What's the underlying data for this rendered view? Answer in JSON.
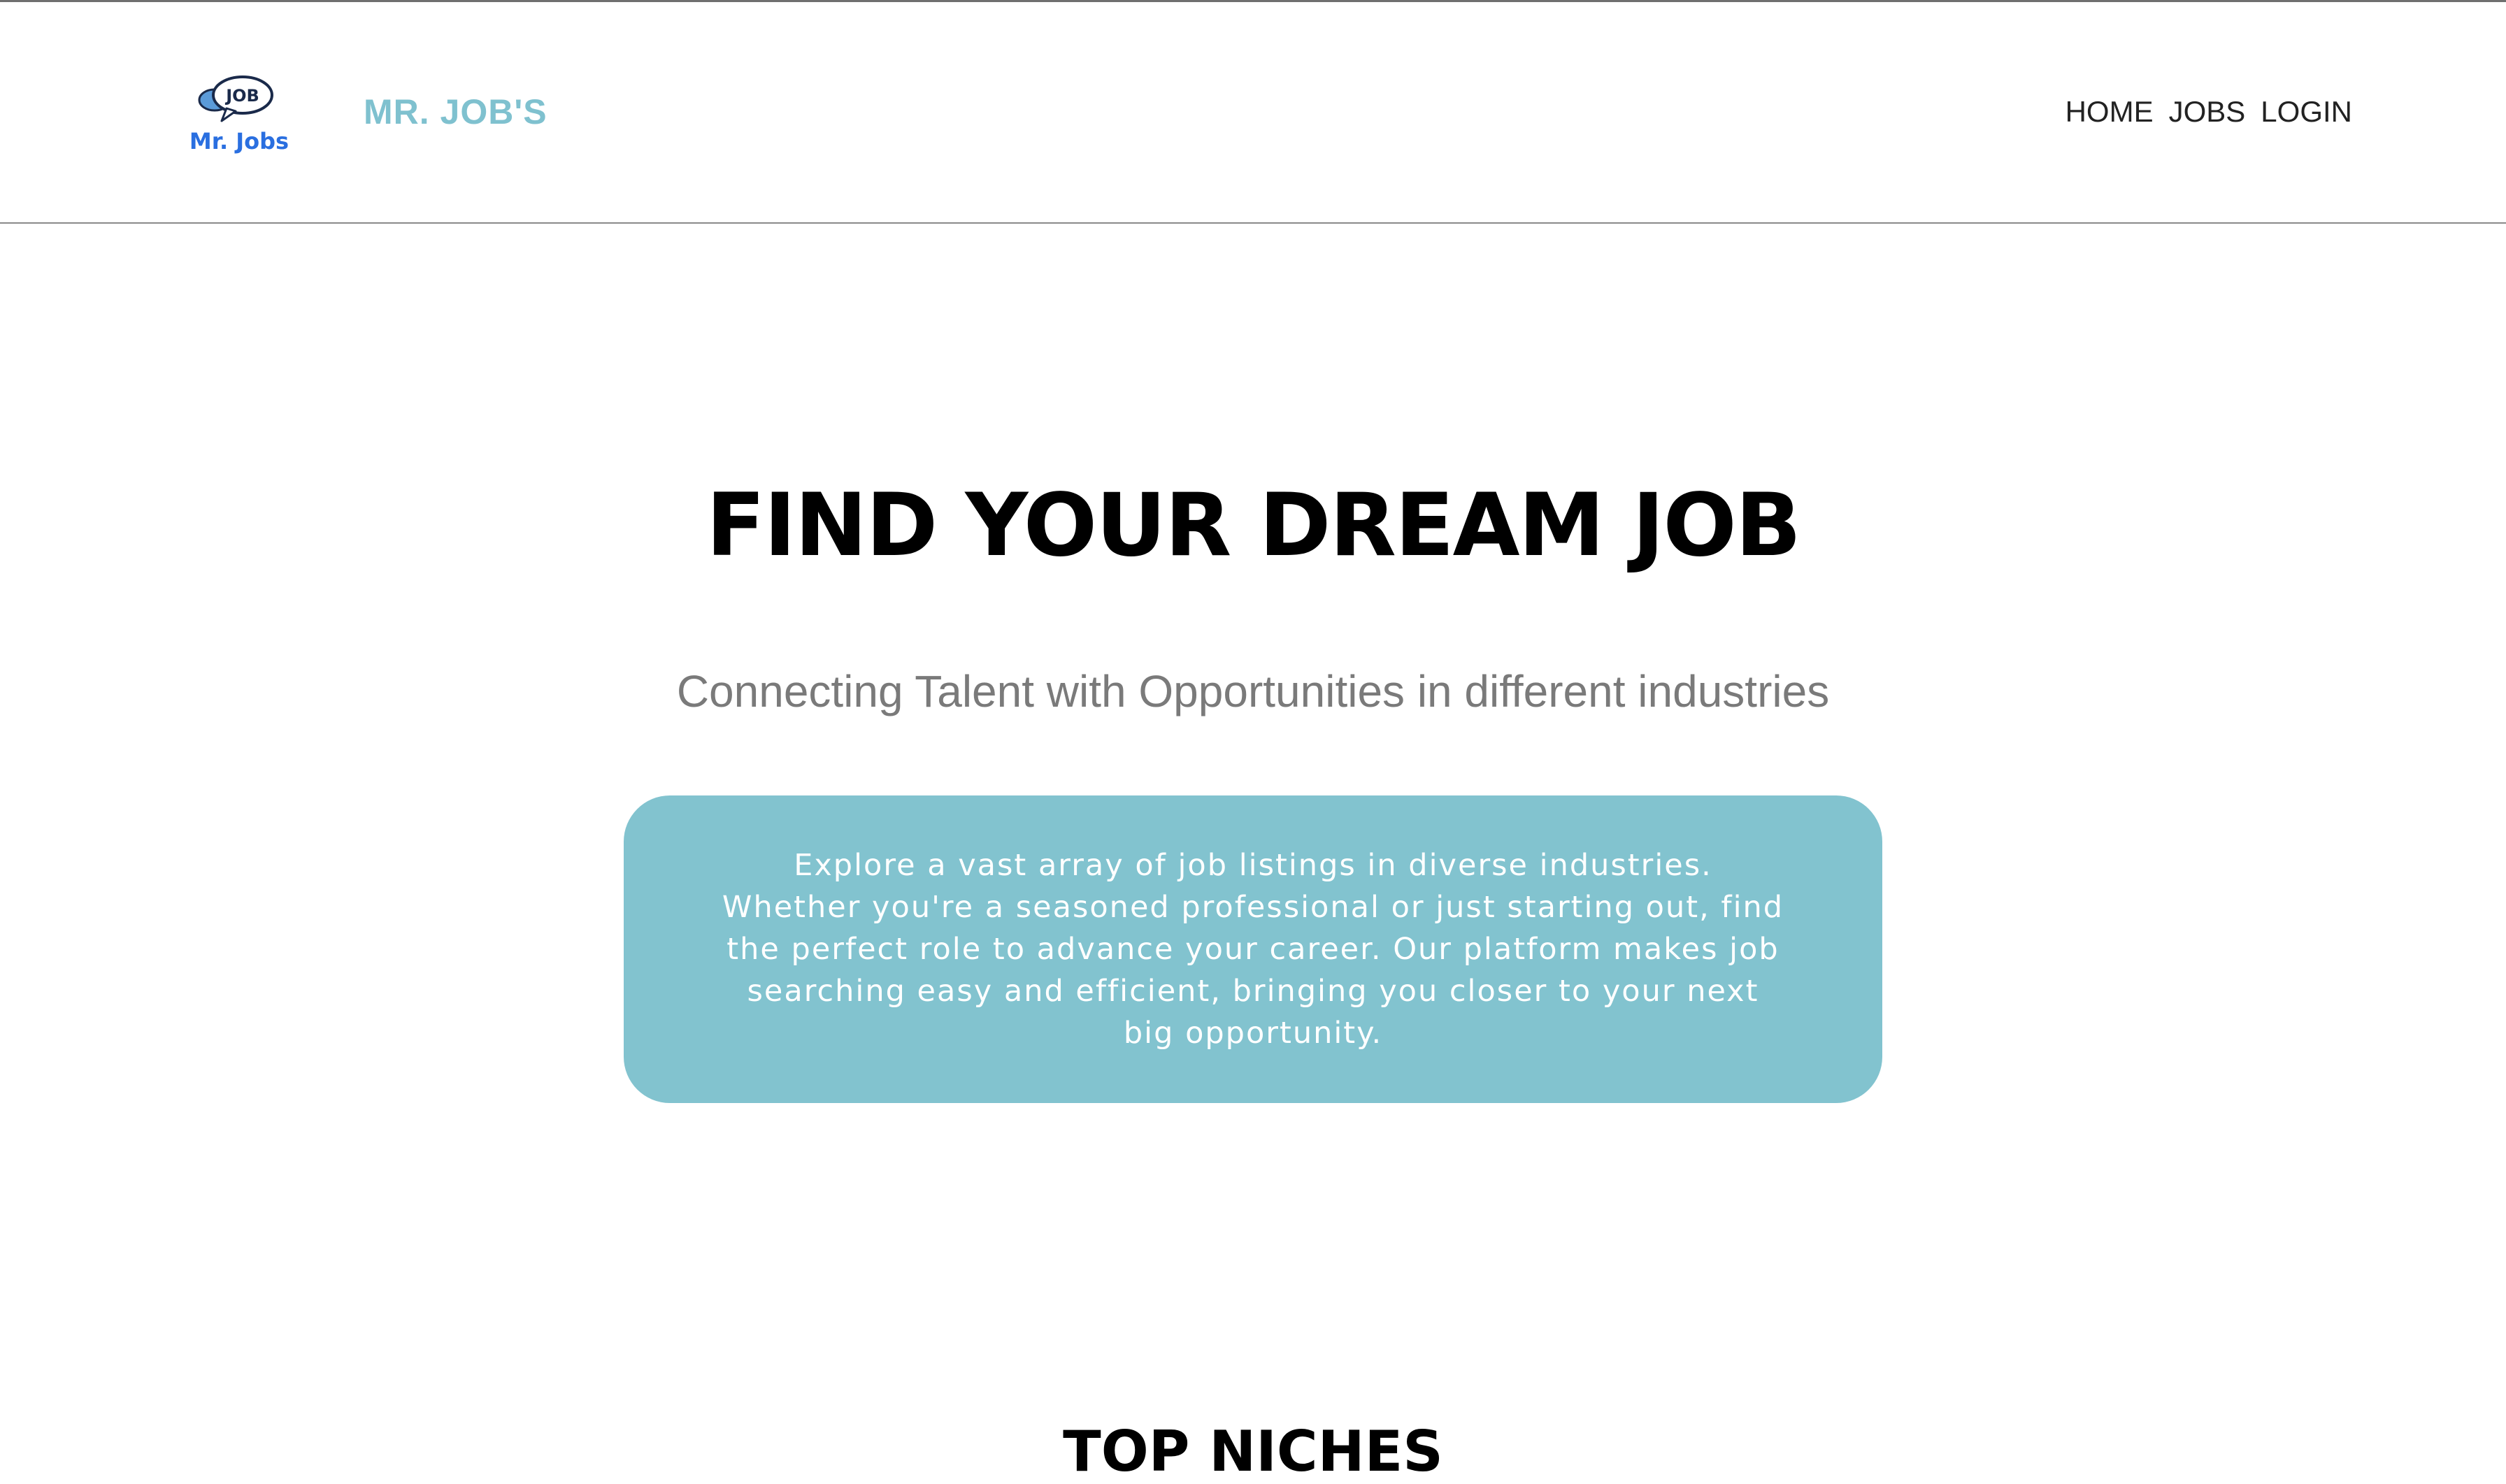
{
  "header": {
    "logo_icon": "speech-bubble-logo",
    "logo_badge_text": "JOB",
    "logo_caption": "Mr. Jobs",
    "brand_name": "MR. JOB'S",
    "nav": [
      {
        "label": "HOME"
      },
      {
        "label": "JOBS"
      },
      {
        "label": "LOGIN"
      }
    ]
  },
  "hero": {
    "title": "FIND YOUR DREAM JOB",
    "subtitle": "Connecting Talent with Opportunities in different industries",
    "intro": "Explore a vast array of job listings in diverse industries. Whether you're a seasoned professional or just starting out, find the perfect role to advance your career. Our platform makes job searching easy and efficient, bringing you closer to your next big opportunity."
  },
  "sections": {
    "top_niches_heading": "TOP NICHES"
  },
  "colors": {
    "accent": "#7fc1cf",
    "card_bg": "#82c3cf",
    "logo_blue": "#2a6fe0"
  }
}
